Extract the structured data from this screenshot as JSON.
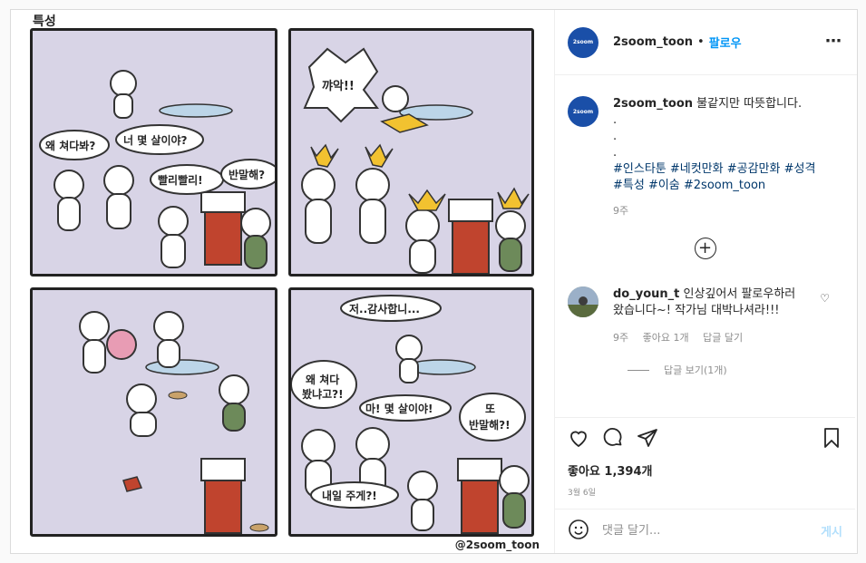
{
  "comic": {
    "title": "특성",
    "watermark": "@2soom_toon",
    "panel1": {
      "bubble_a": "왜 쳐다봐?",
      "bubble_b": "너 몇 살이야?",
      "bubble_c": "빨리빨리!",
      "bubble_d": "반말해?"
    },
    "panel2": {
      "bubble_a": "꺄악!!"
    },
    "panel4": {
      "bubble_a": "저..감사합니...",
      "bubble_b1": "왜 쳐다",
      "bubble_b2": "봤냐고?!",
      "bubble_c": "마! 몇 살이야!",
      "bubble_d1": "또",
      "bubble_d2": "반말해?!",
      "bubble_e": "내일 주게?!"
    }
  },
  "header": {
    "avatar_text": "2soom",
    "username": "2soom_toon",
    "dot": "•",
    "follow_label": "팔로우",
    "more_icon": "more-icon"
  },
  "caption": {
    "username": "2soom_toon",
    "text": "불같지만 따뜻합니다.",
    "dots": [
      ".",
      ".",
      "."
    ],
    "hashtags": "#인스타툰 #네컷만화 #공감만화 #성격 #특성 #이숨 #2soom_toon",
    "time": "9주"
  },
  "comment": {
    "username": "do_youn_t",
    "text": "인상깊어서 팔로우하러왔습니다~! 작가님 대박나셔라!!!",
    "time": "9주",
    "likes": "좋아요 1개",
    "reply": "답글 달기",
    "view_replies": "답글 보기(1개)"
  },
  "actions": {
    "likes": "좋아요 1,394개",
    "date": "3월 6일"
  },
  "add_comment": {
    "placeholder": "댓글 달기...",
    "post_label": "게시"
  }
}
